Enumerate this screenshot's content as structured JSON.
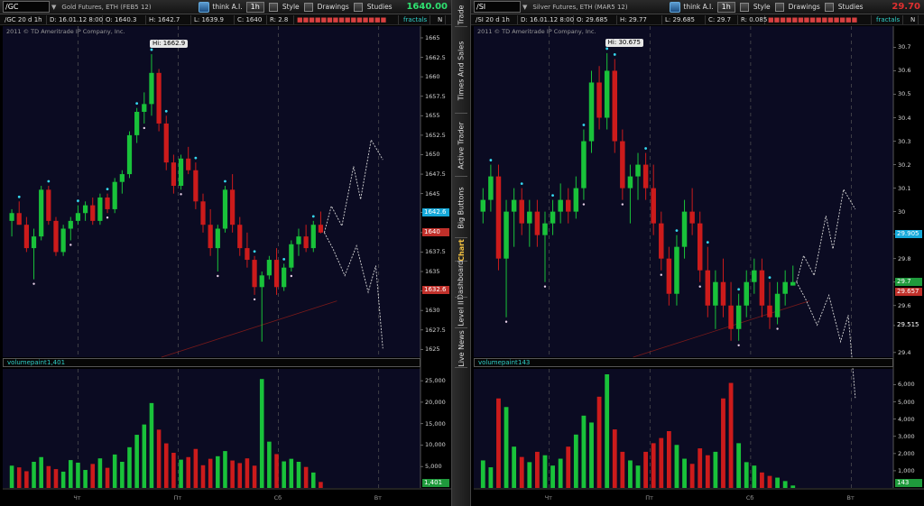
{
  "side_tabs": [
    "Trade",
    "Times And Sales",
    "Active Trader",
    "Big Buttons",
    "Chart",
    "Dashboard",
    "Level II",
    "Live News"
  ],
  "active_tab": "Chart",
  "panels": [
    {
      "id": "left",
      "symbol": "/GC",
      "description": "Gold Futures, ETH (FEB5 12)",
      "account": "think A.I.",
      "timeframe": "1h",
      "toolbar": [
        "Style",
        "Drawings",
        "Studies"
      ],
      "last_price": "1640.00",
      "last_color": "#2fe070",
      "info": {
        "agg": "/GC 20 d 1h",
        "date": "D: 16.01.12 8:00",
        "open": "O: 1640.3",
        "high": "H: 1642.7",
        "low": "L: 1639.9",
        "close": "C: 1640",
        "range": "R: 2.8"
      },
      "study": "fractals",
      "study_end": "N",
      "copyright": "2011 © TD Ameritrade IP Company, Inc.",
      "hi_label": "Hi: 1662.9",
      "volume_title": "volumepaint",
      "volume_value": "1,401",
      "volume_box": "1,401",
      "price_ticks": [
        "1665",
        "1662.5",
        "1660",
        "1657.5",
        "1655",
        "1652.5",
        "1650",
        "1647.5",
        "1645",
        "1642.6",
        "1640",
        "1637.5",
        "1635",
        "1632.5",
        "1630",
        "1627.5",
        "1625"
      ],
      "vol_ticks": [
        "25,000",
        "20,000",
        "15,000",
        "10,000",
        "5,000"
      ],
      "price_boxes": [
        {
          "label": "1642.6",
          "color": "#15a8d8"
        },
        {
          "label": "1640",
          "color": "#c0302a"
        },
        {
          "label": "1632.6",
          "color": "#c0302a"
        }
      ],
      "x_labels": [
        "Чт",
        "Пт",
        "Сб",
        "Вт"
      ],
      "chart_data": {
        "type": "candlestick",
        "y_range": [
          1624,
          1666.5
        ],
        "volume_range": [
          0,
          26500
        ],
        "candles": [
          [
            1641.5,
            1643,
            1639.5,
            1642.5
          ],
          [
            1642.5,
            1644,
            1641,
            1641
          ],
          [
            1641,
            1642,
            1637.5,
            1638
          ],
          [
            1638,
            1640.5,
            1634,
            1639.5
          ],
          [
            1639.5,
            1646,
            1639,
            1645.5
          ],
          [
            1645.5,
            1646,
            1641,
            1641.5
          ],
          [
            1641.5,
            1642,
            1637,
            1637.5
          ],
          [
            1637.5,
            1641,
            1637,
            1640.5
          ],
          [
            1640.5,
            1642,
            1639,
            1641.5
          ],
          [
            1641.5,
            1643.5,
            1641,
            1642.5
          ],
          [
            1642.5,
            1644,
            1641.5,
            1643.5
          ],
          [
            1643.5,
            1644.5,
            1641,
            1641.5
          ],
          [
            1641.5,
            1645,
            1641,
            1644.5
          ],
          [
            1644.5,
            1645,
            1642.5,
            1643
          ],
          [
            1643,
            1647,
            1642.5,
            1646.5
          ],
          [
            1646.5,
            1648,
            1645,
            1647.5
          ],
          [
            1647.5,
            1653,
            1647,
            1652.5
          ],
          [
            1652.5,
            1656,
            1651.5,
            1655.5
          ],
          [
            1655.5,
            1658,
            1654,
            1656.5
          ],
          [
            1656.5,
            1662.9,
            1655,
            1660.5
          ],
          [
            1660.5,
            1661,
            1653,
            1654
          ],
          [
            1654,
            1655,
            1648,
            1649
          ],
          [
            1649,
            1650,
            1645,
            1646
          ],
          [
            1646,
            1650,
            1645.5,
            1649.5
          ],
          [
            1649.5,
            1651,
            1647.5,
            1648
          ],
          [
            1648,
            1649,
            1643,
            1644
          ],
          [
            1644,
            1645,
            1640,
            1641
          ],
          [
            1641,
            1643,
            1637,
            1638
          ],
          [
            1638,
            1641,
            1635,
            1640.5
          ],
          [
            1640.5,
            1646,
            1640,
            1645.5
          ],
          [
            1645.5,
            1647.5,
            1640,
            1641
          ],
          [
            1641,
            1642,
            1637,
            1638
          ],
          [
            1638,
            1640,
            1635.5,
            1636.5
          ],
          [
            1636.5,
            1637,
            1632,
            1633
          ],
          [
            1633,
            1635,
            1626,
            1634.5
          ],
          [
            1634.5,
            1637,
            1634,
            1636.5
          ],
          [
            1636.5,
            1638,
            1632,
            1633
          ],
          [
            1633,
            1636,
            1632.5,
            1635.5
          ],
          [
            1635.5,
            1639,
            1635,
            1638.5
          ],
          [
            1638.5,
            1640.5,
            1637,
            1639.5
          ],
          [
            1639.5,
            1641,
            1637.5,
            1638
          ],
          [
            1638,
            1641.5,
            1637.5,
            1641
          ],
          [
            1641,
            1642.7,
            1639.9,
            1640
          ]
        ],
        "volumes": [
          5200,
          4800,
          3900,
          6100,
          7200,
          5100,
          4400,
          3800,
          6500,
          5900,
          4200,
          5600,
          6900,
          4700,
          7800,
          6100,
          9500,
          12400,
          14800,
          19800,
          13600,
          10400,
          8200,
          6600,
          7200,
          9100,
          5300,
          6800,
          7400,
          8600,
          6400,
          5800,
          6900,
          5200,
          25400,
          10800,
          7900,
          6200,
          6800,
          6100,
          4900,
          3600,
          1401
        ]
      }
    },
    {
      "id": "right",
      "symbol": "/SI",
      "description": "Silver Futures, ETH (MAR5 12)",
      "account": "think A.I.",
      "timeframe": "1h",
      "toolbar": [
        "Style",
        "Drawings",
        "Studies"
      ],
      "last_price": "29.70",
      "last_color": "#e03030",
      "info": {
        "agg": "/SI 20 d 1h",
        "date": "D: 16.01.12 8:00",
        "open": "O: 29.685",
        "high": "H: 29.77",
        "low": "L: 29.685",
        "close": "C: 29.7",
        "range": "R: 0.085"
      },
      "study": "fractals",
      "study_end": "N",
      "copyright": "2011 © TD Ameritrade IP Company, Inc.",
      "hi_label": "Hi: 30.675",
      "volume_title": "volumepaint",
      "volume_value": "143",
      "volume_box": "143",
      "price_ticks": [
        "30.7",
        "30.6",
        "30.5",
        "30.4",
        "30.3",
        "30.2",
        "30.1",
        "30",
        "29.905",
        "29.8",
        "29.7",
        "29.6",
        "29.515",
        "29.4"
      ],
      "vol_ticks": [
        "6,000",
        "5,000",
        "4,000",
        "3,000",
        "2,000",
        "1,000"
      ],
      "price_boxes": [
        {
          "label": "29.905",
          "color": "#15a8d8"
        },
        {
          "label": "29.7",
          "color": "#1f9a3c"
        },
        {
          "label": "29.657",
          "color": "#c0302a"
        },
        {
          "label": "29.515",
          "color": "#000000"
        }
      ],
      "x_labels": [
        "Чт",
        "Пт",
        "Сб",
        "Вт"
      ],
      "chart_data": {
        "type": "candlestick",
        "y_range": [
          29.38,
          30.79
        ],
        "volume_range": [
          0,
          6600
        ],
        "candles": [
          [
            30.0,
            30.1,
            29.95,
            30.05
          ],
          [
            30.05,
            30.2,
            30.0,
            30.15
          ],
          [
            30.15,
            30.2,
            29.75,
            29.8
          ],
          [
            29.8,
            30.05,
            29.55,
            30.0
          ],
          [
            30.0,
            30.1,
            29.85,
            30.05
          ],
          [
            30.05,
            30.1,
            29.9,
            29.95
          ],
          [
            29.95,
            30.05,
            29.85,
            30.0
          ],
          [
            30.0,
            30.05,
            29.85,
            29.9
          ],
          [
            29.9,
            30.0,
            29.7,
            29.95
          ],
          [
            29.95,
            30.05,
            29.9,
            30.0
          ],
          [
            30.0,
            30.12,
            29.95,
            30.05
          ],
          [
            30.05,
            30.1,
            29.95,
            30.0
          ],
          [
            30.0,
            30.15,
            29.97,
            30.1
          ],
          [
            30.1,
            30.35,
            30.05,
            30.3
          ],
          [
            30.3,
            30.6,
            30.25,
            30.55
          ],
          [
            30.55,
            30.62,
            30.35,
            30.4
          ],
          [
            30.4,
            30.675,
            30.35,
            30.6
          ],
          [
            30.6,
            30.65,
            30.25,
            30.3
          ],
          [
            30.3,
            30.35,
            30.05,
            30.1
          ],
          [
            30.1,
            30.2,
            29.95,
            30.15
          ],
          [
            30.15,
            30.25,
            30.05,
            30.2
          ],
          [
            30.2,
            30.25,
            30.05,
            30.1
          ],
          [
            30.1,
            30.2,
            29.9,
            29.95
          ],
          [
            29.95,
            30.0,
            29.75,
            29.8
          ],
          [
            29.8,
            29.85,
            29.6,
            29.65
          ],
          [
            29.65,
            29.9,
            29.6,
            29.85
          ],
          [
            29.85,
            30.05,
            29.8,
            30.0
          ],
          [
            30.0,
            30.1,
            29.9,
            29.95
          ],
          [
            29.95,
            30.0,
            29.7,
            29.75
          ],
          [
            29.75,
            29.85,
            29.55,
            29.6
          ],
          [
            29.6,
            29.75,
            29.5,
            29.7
          ],
          [
            29.7,
            29.8,
            29.55,
            29.6
          ],
          [
            29.6,
            29.7,
            29.45,
            29.5
          ],
          [
            29.5,
            29.65,
            29.45,
            29.6
          ],
          [
            29.6,
            29.75,
            29.55,
            29.7
          ],
          [
            29.7,
            29.8,
            29.65,
            29.75
          ],
          [
            29.75,
            29.8,
            29.55,
            29.6
          ],
          [
            29.6,
            29.7,
            29.5,
            29.55
          ],
          [
            29.55,
            29.7,
            29.52,
            29.65
          ],
          [
            29.65,
            29.75,
            29.6,
            29.7
          ],
          [
            29.685,
            29.77,
            29.685,
            29.7
          ]
        ],
        "volumes": [
          1600,
          1200,
          5200,
          4700,
          2400,
          1800,
          1500,
          2100,
          1900,
          1300,
          1700,
          2400,
          3100,
          4200,
          3800,
          5300,
          6600,
          3400,
          2100,
          1600,
          1300,
          2100,
          2600,
          2900,
          3300,
          2500,
          1700,
          1400,
          2300,
          1900,
          2100,
          5200,
          6100,
          2600,
          1500,
          1300,
          900,
          700,
          600,
          400,
          143
        ]
      }
    }
  ]
}
